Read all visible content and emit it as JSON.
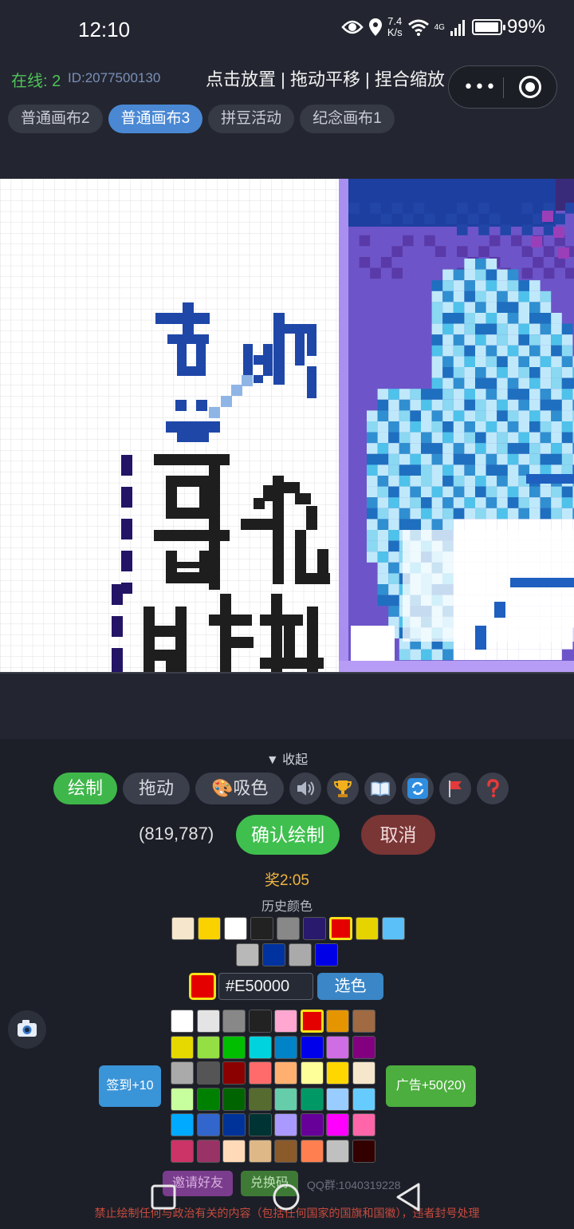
{
  "status_bar": {
    "time": "12:10",
    "speed_value": "7.4",
    "speed_unit": "K/s",
    "network": "4G",
    "battery": "99%"
  },
  "info_bar": {
    "online": "在线: 2",
    "user_id": "ID:2077500130",
    "hint": "点击放置 | 拖动平移 | 捏合缩放"
  },
  "tabs": [
    {
      "label": "普通画布2",
      "active": false
    },
    {
      "label": "普通画布3",
      "active": true
    },
    {
      "label": "拼豆活动",
      "active": false
    },
    {
      "label": "纪念画布1",
      "active": false
    }
  ],
  "panel": {
    "collapse_label": "▼ 收起",
    "tools": {
      "draw": "绘制",
      "drag": "拖动",
      "pick": "🎨吸色"
    },
    "icons": [
      "speaker-icon",
      "trophy-icon",
      "book-icon",
      "refresh-icon",
      "flag-icon",
      "question-icon"
    ],
    "coords": "(819,787)",
    "confirm": "确认绘制",
    "cancel": "取消",
    "reward": "奖2:05",
    "history_label": "历史颜色",
    "history_colors": [
      "#f5e6cc",
      "#f9d200",
      "#ffffff",
      "#222222",
      "#888888",
      "#2a1a6e",
      "#e50000",
      "#e6d400",
      "#5bc0f8",
      "#b8b8b8",
      "#0033a0",
      "#aaaaaa",
      "#0000e6"
    ],
    "current_color": "#e50000",
    "hex_value": "#E50000",
    "pick_button": "选色",
    "palette": [
      "#ffffff",
      "#e4e4e4",
      "#888888",
      "#222222",
      "#ffa7d1",
      "#e50000",
      "#e59500",
      "#a06a42",
      "#e5d900",
      "#94e044",
      "#02be01",
      "#00d3dd",
      "#0083c7",
      "#0000ea",
      "#cf6ee4",
      "#820080",
      "#aaaaaa",
      "#555555",
      "#8b0000",
      "#ff6b6b",
      "#ffb070",
      "#ffff99",
      "#ffd700",
      "#f5e6cc",
      "#c8ff9e",
      "#008000",
      "#006400",
      "#556b2f",
      "#66cdaa",
      "#009966",
      "#99ccff",
      "#66ccff",
      "#00aaff",
      "#3366cc",
      "#003399",
      "#003333",
      "#aa99ff",
      "#660099",
      "#ff00ff",
      "#ff66aa",
      "#cc3366",
      "#993366",
      "#ffdab9",
      "#deb887",
      "#8b5a2b",
      "#ff7f50",
      "#c0c0c0",
      "#330000"
    ],
    "selected_palette_index": 5,
    "checkin": "签到+10",
    "ad": "广告+50(20)"
  },
  "footer": {
    "invite": "邀请好友",
    "redeem": "兑换码",
    "qq": "QQ群:1040319228",
    "warning": "禁止绘制任何与政治有关的内容（包括任何国家的国旗和国徽），违者封号处理"
  }
}
